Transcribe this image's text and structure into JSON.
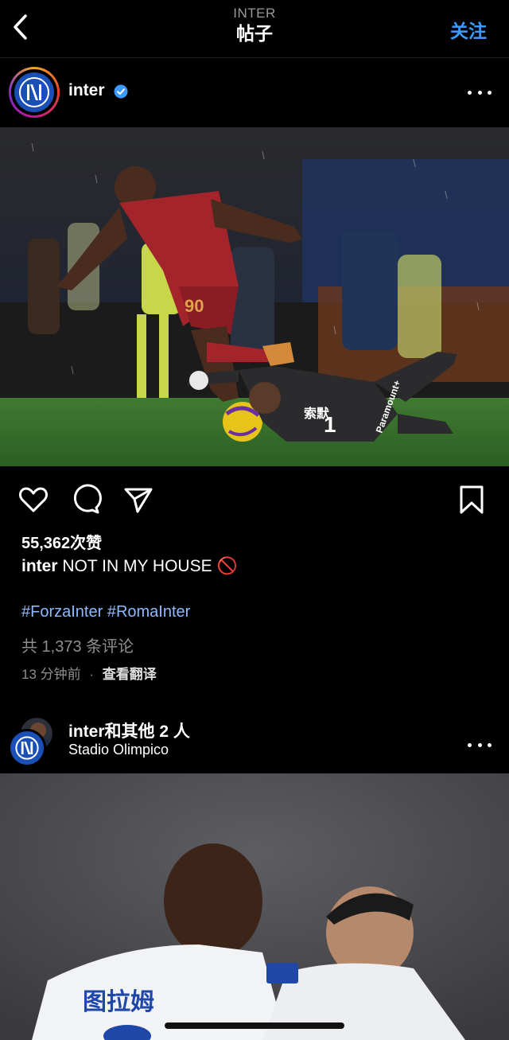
{
  "nav": {
    "subtitle": "INTER",
    "title": "帖子",
    "follow_label": "关注"
  },
  "post1": {
    "username": "inter",
    "likes": "55,362次赞",
    "caption_user": "inter",
    "caption_text": "NOT IN MY HOUSE 🚫",
    "hashtags": "#ForzaInter #RomaInter",
    "comments": "共 1,373 条评论",
    "time": "13 分钟前",
    "separator": "·",
    "translate": "查看翻译",
    "photo": {
      "keeper_name": "索默",
      "keeper_number": "1",
      "sponsor": "Paramount+",
      "attacker_number": "90"
    }
  },
  "post2": {
    "username": "inter和其他 2 人",
    "location": "Stadio Olimpico",
    "photo": {
      "player_name": "图拉姆"
    }
  },
  "colors": {
    "accent": "#3b9bff",
    "hashtag": "#8fb9ff",
    "roma_red": "#a3242b",
    "inter_blue": "#1a4fb5"
  },
  "icons": [
    "back-chevron-icon",
    "verified-badge-icon",
    "more-options-icon",
    "heart-icon",
    "comment-icon",
    "share-icon",
    "bookmark-icon"
  ]
}
